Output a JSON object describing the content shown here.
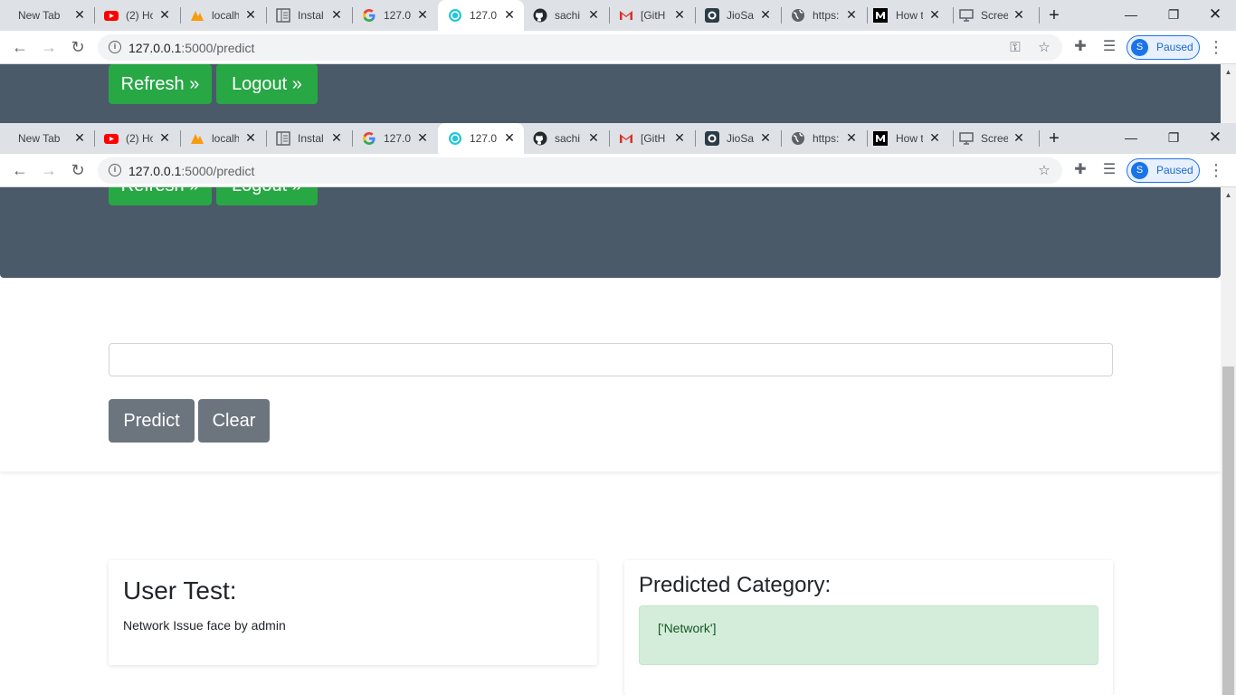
{
  "browser": {
    "tabs": [
      {
        "label": "New Tab",
        "icon": "none"
      },
      {
        "label": "(2) Ho",
        "icon": "youtube-icon"
      },
      {
        "label": "localh",
        "icon": "phpmyadmin-icon"
      },
      {
        "label": "Instal",
        "icon": "document-icon"
      },
      {
        "label": "127.0",
        "icon": "google-icon"
      },
      {
        "label": "127.0",
        "icon": "app-icon"
      },
      {
        "label": "sachi",
        "icon": "github-icon"
      },
      {
        "label": "[GitH",
        "icon": "gmail-icon"
      },
      {
        "label": "JioSa",
        "icon": "jiosaavn-icon"
      },
      {
        "label": "https:",
        "icon": "globe-icon"
      },
      {
        "label": "How t",
        "icon": "medium-icon"
      },
      {
        "label": "Scree",
        "icon": "screen-icon"
      }
    ],
    "url_host": "127.0.0.1",
    "url_path": ":5000/predict",
    "profile_initial": "S",
    "profile_status": "Paused",
    "colors": {
      "accent": "#1a73e8",
      "tabstrip": "#dee1e6"
    }
  },
  "header": {
    "refresh_label": "Refresh »",
    "logout_label": "Logout »"
  },
  "form": {
    "input_value": "",
    "predict_label": "Predict",
    "clear_label": "Clear"
  },
  "results": {
    "user_test_title": "User Test:",
    "user_test_text": "Network Issue face by admin",
    "predicted_title": "Predicted Category:",
    "predicted_value": "['Network']"
  },
  "colors": {
    "header_bg": "#4a5a69",
    "btn_green": "#28a745",
    "btn_gray": "#6c757d",
    "success_bg": "#d4edda"
  }
}
